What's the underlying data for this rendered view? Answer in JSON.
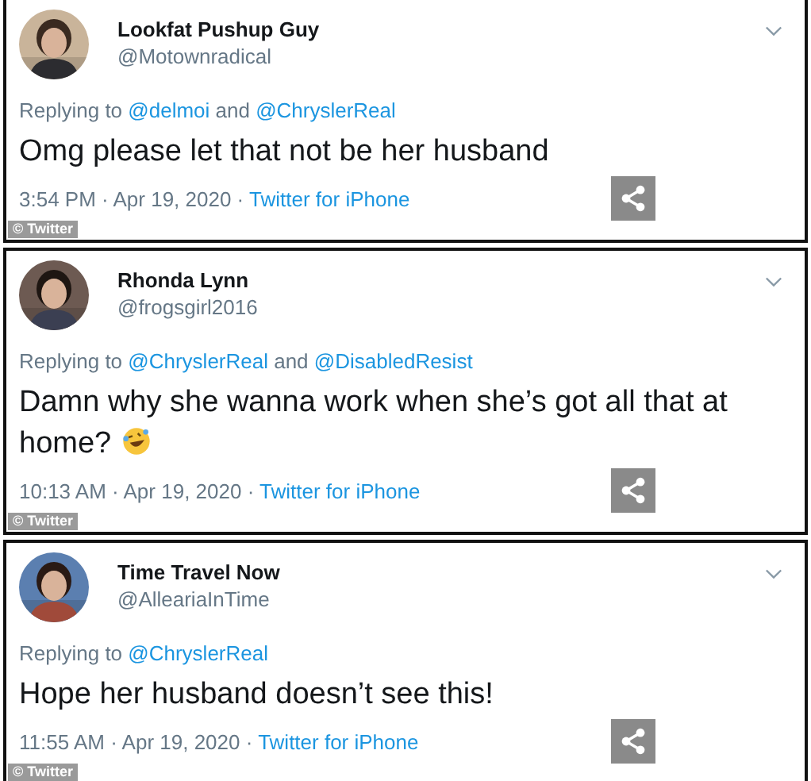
{
  "tweets": [
    {
      "name": "Lookfat Pushup Guy",
      "handle": "@Motownradical",
      "replying_prefix": "Replying to",
      "mentions": [
        "@delmoi",
        "@ChryslerReal"
      ],
      "mention_joiner": "and",
      "body": "Omg please let that not be her husband",
      "time": "3:54 PM · Apr 19, 2020 ·",
      "source": "Twitter for iPhone",
      "credit": "© Twitter",
      "avatar": {
        "kind": "picture"
      }
    },
    {
      "name": "Rhonda Lynn",
      "handle": "@frogsgirl2016",
      "replying_prefix": "Replying to",
      "mentions": [
        "@ChryslerReal",
        "@DisabledResist"
      ],
      "mention_joiner": "and",
      "body": "Damn why she wanna work when she’s got all that at home?",
      "laughing_emoji": true,
      "time": "10:13 AM · Apr 19, 2020 ·",
      "source": "Twitter for iPhone",
      "credit": "© Twitter",
      "avatar": {
        "kind": "picture"
      }
    },
    {
      "name": "Time Travel Now",
      "handle": "@AlleariaInTime",
      "replying_prefix": "Replying to",
      "mentions": [
        "@ChryslerReal"
      ],
      "body": "Hope her husband doesn’t see this!",
      "time": "11:55 AM · Apr 19, 2020 ·",
      "source": "Twitter for iPhone",
      "credit": "© Twitter",
      "avatar": {
        "kind": "picture"
      }
    }
  ]
}
